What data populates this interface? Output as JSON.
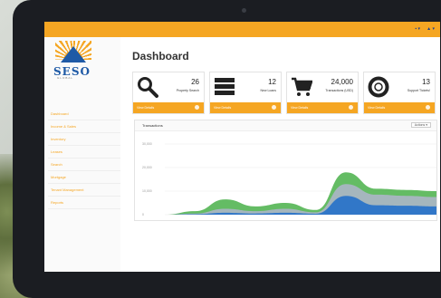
{
  "topbar": {
    "items": [
      "▪ ▾",
      "▲ ▾"
    ],
    "accent": "#f5a623"
  },
  "brand": {
    "name": "SESO",
    "subtitle": "GLOBAL"
  },
  "sidebar": {
    "items": [
      {
        "label": "Dashboard"
      },
      {
        "label": "Income & Sales"
      },
      {
        "label": "Inventory"
      },
      {
        "label": "Leases"
      },
      {
        "label": "Search"
      },
      {
        "label": "Mortgage"
      },
      {
        "label": "Tenant Management"
      },
      {
        "label": "Reports"
      }
    ]
  },
  "main": {
    "title": "Dashboard",
    "cards": [
      {
        "value": "26",
        "label": "Property Search",
        "footer": "View Details",
        "icon": "search-icon"
      },
      {
        "value": "12",
        "label": "New Loans",
        "footer": "View Details",
        "icon": "server-icon"
      },
      {
        "value": "24,000",
        "label": "Transactions (USD)",
        "footer": "View Details",
        "icon": "cart-icon"
      },
      {
        "value": "13",
        "label": "Support Tickets!",
        "footer": "View Details",
        "icon": "lifebuoy-icon"
      }
    ],
    "panel": {
      "title": "Transactions",
      "actions_label": "Actions ▾",
      "y_labels": [
        "30,000",
        "20,000",
        "10,000",
        "0"
      ]
    }
  },
  "chart_data": {
    "type": "area",
    "x": [
      0,
      1,
      2,
      3,
      4,
      5,
      6,
      7,
      8,
      9
    ],
    "series": [
      {
        "color": "#5cb85c",
        "values": [
          0,
          1500,
          6500,
          3500,
          5000,
          2000,
          18000,
          11000,
          10500,
          10000
        ]
      },
      {
        "color": "#a9b5c2",
        "values": [
          0,
          500,
          2500,
          1500,
          2500,
          1000,
          13000,
          8500,
          8000,
          7500
        ]
      },
      {
        "color": "#2a74c8",
        "values": [
          0,
          200,
          800,
          500,
          800,
          400,
          8000,
          4000,
          3800,
          3500
        ]
      }
    ],
    "ylim": [
      0,
      30000
    ]
  }
}
